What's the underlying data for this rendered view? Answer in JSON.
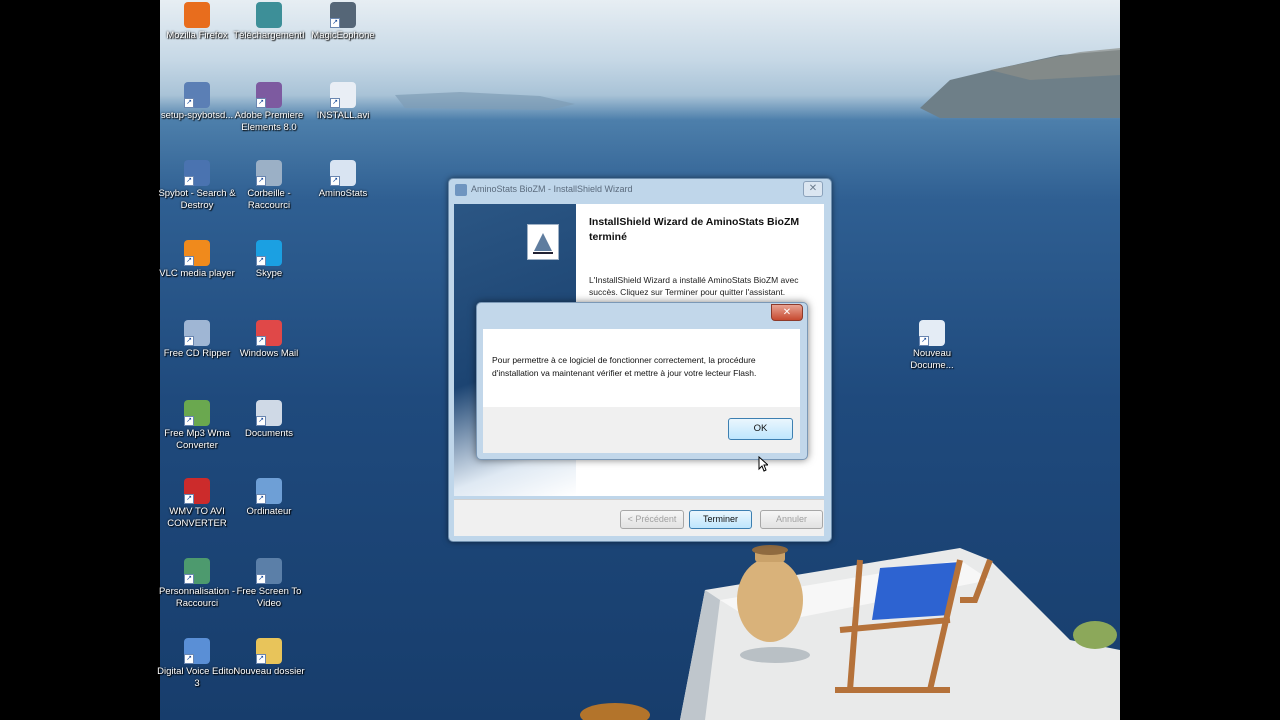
{
  "desktop": {
    "icons": [
      {
        "label": "Mozilla Firefox",
        "icon": "firefox-icon",
        "color": "#e86d1d"
      },
      {
        "label": "TéléchargementI",
        "icon": "download-folder-icon",
        "color": "#3d8f98"
      },
      {
        "label": "MagicEophone",
        "icon": "microphone-icon",
        "color": "#556677"
      },
      {
        "label": "setup-spybotsd...",
        "icon": "setup-icon",
        "color": "#5b7fb5"
      },
      {
        "label": "Adobe Premiere Elements 8.0",
        "icon": "adobe-premiere-icon",
        "color": "#7d5aa0"
      },
      {
        "label": "INSTALL.avi",
        "icon": "video-file-icon",
        "color": "#e9eef5"
      },
      {
        "label": "Spybot - Search & Destroy",
        "icon": "spybot-icon",
        "color": "#4a73b0"
      },
      {
        "label": "Corbeille - Raccourci",
        "icon": "recycle-bin-icon",
        "color": "#9bb0c6"
      },
      {
        "label": "AminoStats",
        "icon": "aminostats-icon",
        "color": "#d9e4f2"
      },
      {
        "label": "VLC media player",
        "icon": "vlc-icon",
        "color": "#f08a1c"
      },
      {
        "label": "Skype",
        "icon": "skype-icon",
        "color": "#1ba0e2"
      },
      {
        "label": "Free CD Ripper",
        "icon": "cd-icon",
        "color": "#9fb6d4"
      },
      {
        "label": "Windows Mail",
        "icon": "mail-icon",
        "color": "#e04848"
      },
      {
        "label": "Free Mp3 Wma Converter",
        "icon": "converter-icon",
        "color": "#6aa84f"
      },
      {
        "label": "Documents",
        "icon": "documents-icon",
        "color": "#cfd9e6"
      },
      {
        "label": "WMV TO AVI CONVERTER",
        "icon": "wmv-avi-icon",
        "color": "#cc2b2b"
      },
      {
        "label": "Ordinateur",
        "icon": "computer-icon",
        "color": "#6e9fd6"
      },
      {
        "label": "Personnalisation - Raccourci",
        "icon": "personalize-icon",
        "color": "#4d9a6e"
      },
      {
        "label": "Free Screen To Video",
        "icon": "screen-video-icon",
        "color": "#5b7fa8"
      },
      {
        "label": "Digital Voice Editor 3",
        "icon": "voice-editor-icon",
        "color": "#5a8fd6"
      },
      {
        "label": "Nouveau dossier",
        "icon": "folder-icon",
        "color": "#e8c45a"
      },
      {
        "label": "Nouveau Docume...",
        "icon": "word-document-icon",
        "color": "#e4ecf5"
      }
    ]
  },
  "wizard": {
    "title": "AminoStats BioZM - InstallShield Wizard",
    "close_label": "✕",
    "heading": "InstallShield Wizard de AminoStats BioZM terminé",
    "text": "L'InstallShield Wizard a installé AminoStats BioZM avec succès. Cliquez sur Terminer pour quitter l'assistant.",
    "buttons": {
      "back": "< Précédent",
      "finish": "Terminer",
      "cancel": "Annuler"
    }
  },
  "messagebox": {
    "close_label": "✕",
    "message": "Pour permettre à ce logiciel de fonctionner correctement, la procédure d'installation va maintenant vérifier et mettre à jour votre lecteur Flash.",
    "ok_label": "OK"
  }
}
